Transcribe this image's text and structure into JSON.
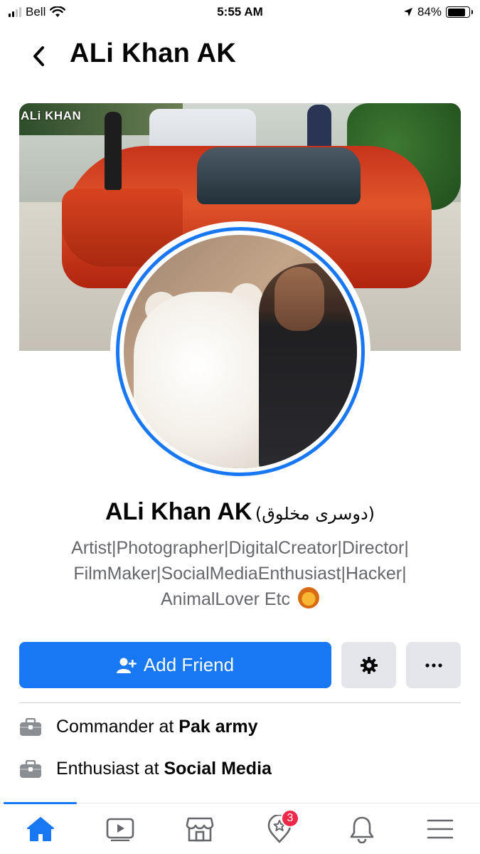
{
  "status_bar": {
    "carrier": "Bell",
    "time": "5:55 AM",
    "battery_percent": "84%",
    "battery_level": 0.84,
    "icons": [
      "signal-icon",
      "wifi-icon",
      "location-arrow-icon",
      "battery-icon"
    ]
  },
  "header": {
    "title": "ALi Khan AK",
    "back_icon": "chevron-left-icon"
  },
  "cover": {
    "watermark": "ALi KHAN"
  },
  "profile": {
    "name": "ALi Khan AK",
    "alt_name": "(دوسری مخلوق)",
    "bio_lines": [
      "Artist|Photographer|DigitalCreator|Director|",
      "FilmMaker|SocialMediaEnthusiast|Hacker|",
      "AnimalLover Etc"
    ],
    "bio_emoji": "lion-face-icon"
  },
  "actions": {
    "add_friend_label": "Add Friend",
    "add_friend_icon": "add-person-icon",
    "settings_icon": "gear-icon",
    "more_icon": "more-dots-icon"
  },
  "info": [
    {
      "prefix": "Commander at ",
      "bold": "Pak army",
      "icon": "briefcase-icon"
    },
    {
      "prefix": "Enthusiast at ",
      "bold": "Social Media",
      "icon": "briefcase-icon"
    }
  ],
  "tabbar": {
    "tabs": [
      "home-icon",
      "watch-icon",
      "marketplace-icon",
      "dating-icon",
      "notifications-icon",
      "menu-icon"
    ],
    "active": "home-icon",
    "dating_badge": "3"
  },
  "colors": {
    "accent": "#1877f2",
    "badge": "#f02849",
    "secondary_text": "#65676b",
    "button_gray": "#e4e6eb"
  }
}
